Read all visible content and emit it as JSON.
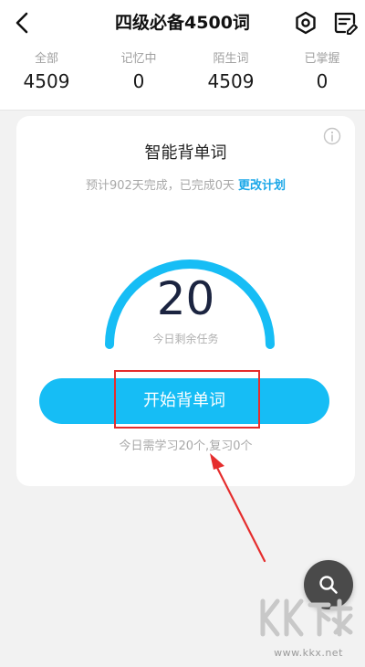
{
  "header": {
    "title": "四级必备4500词",
    "icons": [
      "back-icon",
      "settings-icon",
      "word-list-icon"
    ]
  },
  "stats": [
    {
      "label": "全部",
      "value": "4509"
    },
    {
      "label": "记忆中",
      "value": "0"
    },
    {
      "label": "陌生词",
      "value": "4509"
    },
    {
      "label": "已掌握",
      "value": "0"
    }
  ],
  "card": {
    "title": "智能背单词",
    "plan_text": "预计902天完成，已完成0天",
    "plan_link": "更改计划",
    "remaining_value": "20",
    "remaining_caption": "今日剩余任务",
    "start_button": "开始背单词",
    "today_text": "今日需学习20个,复习0个"
  },
  "fab": {
    "icon": "search-icon"
  },
  "watermark": {
    "url": "www.kkx.net"
  },
  "colors": {
    "accent": "#16bdf5",
    "link": "#1aa7e8",
    "annotation": "#e52d2d",
    "fab": "#4a4a4a"
  }
}
